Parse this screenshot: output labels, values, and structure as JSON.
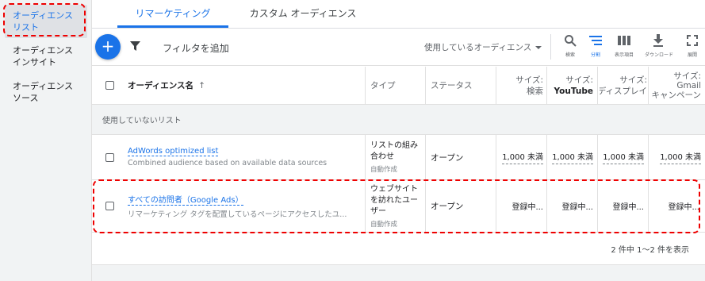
{
  "sidebar": {
    "items": [
      {
        "line1": "オーディエンス",
        "line2": "リスト"
      },
      {
        "line1": "オーディエンス",
        "line2": "インサイト"
      },
      {
        "line1": "オーディエンス",
        "line2": "ソース"
      }
    ]
  },
  "tabs": [
    {
      "label": "リマーケティング"
    },
    {
      "label": "カスタム オーディエンス"
    }
  ],
  "toolbar": {
    "add_label": "+",
    "filter_label": "フィルタを追加",
    "audience_select": "使用しているオーディエンス",
    "tools": [
      {
        "label": "検索",
        "icon": "search-icon"
      },
      {
        "label": "分割",
        "icon": "segment-icon"
      },
      {
        "label": "表示項目",
        "icon": "columns-icon"
      },
      {
        "label": "ダウンロード",
        "icon": "download-icon"
      },
      {
        "label": "展開",
        "icon": "expand-icon"
      }
    ]
  },
  "table": {
    "headers": {
      "name": "オーディエンス名",
      "sort": "↑",
      "type": "タイプ",
      "status": "ステータス",
      "size_search": {
        "line1": "サイズ:",
        "line2": "検索"
      },
      "size_youtube": {
        "line1": "サイズ:",
        "line2": "YouTube"
      },
      "size_display": {
        "line1": "サイズ:",
        "line2": "ディスプレイ"
      },
      "size_gmail": {
        "line1": "サイズ:",
        "line2": "Gmail",
        "line3": "キャンペーン"
      }
    },
    "group_label": "使用していないリスト",
    "rows": [
      {
        "name": "AdWords optimized list",
        "desc": "Combined audience based on available data sources",
        "type_line1": "リストの組み",
        "type_line2": "合わせ",
        "type_sub": "自動作成",
        "status": "オープン",
        "size_search": "1,000 未満",
        "size_youtube": "1,000 未満",
        "size_display": "1,000 未満",
        "size_gmail": "1,000 未満"
      },
      {
        "name": "すべての訪問者（Google Ads）",
        "desc": "リマーケティング タグを配置しているページにアクセスしたユ...",
        "type_line1": "ウェブサイト",
        "type_line2": "を訪れたユー",
        "type_line3": "ザー",
        "type_sub": "自動作成",
        "status": "オープン",
        "size_search": "登録中...",
        "size_youtube": "登録中...",
        "size_display": "登録中...",
        "size_gmail": "登録中..."
      }
    ],
    "pager": "2 件中 1～2 件を表示"
  },
  "colors": {
    "accent": "#1a73e8",
    "highlight": "#ee0000"
  }
}
